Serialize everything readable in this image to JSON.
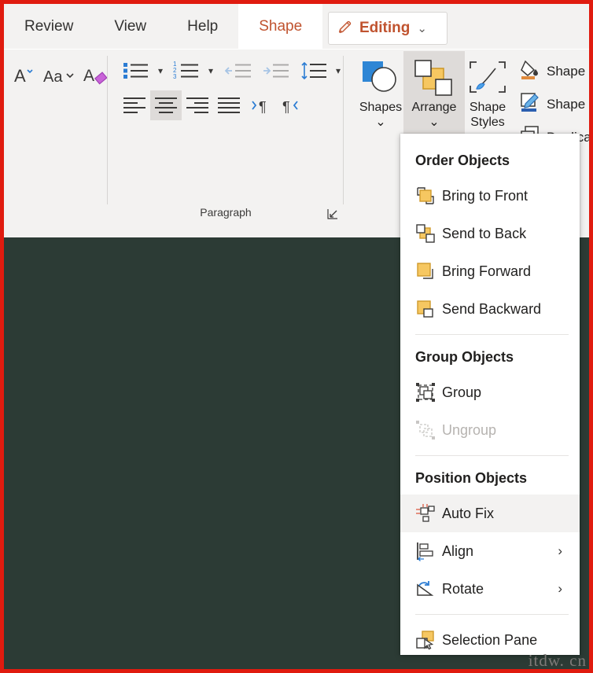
{
  "window": {
    "capture_border_color": "#e01b0f",
    "canvas_color": "#2c3b35",
    "chrome_color": "#f3f2f1",
    "accent_color": "#c0532f"
  },
  "tabs": [
    {
      "label": "Review",
      "selected": false
    },
    {
      "label": "View",
      "selected": false
    },
    {
      "label": "Help",
      "selected": false
    },
    {
      "label": "Shape",
      "selected": true
    }
  ],
  "editing_button": {
    "label": "Editing",
    "icon": "pencil-icon",
    "chevron": "⌄"
  },
  "ribbon": {
    "font_group": {
      "commands": [
        {
          "name": "increase-font-size",
          "glyph": "A",
          "enabled": true
        },
        {
          "name": "change-case",
          "glyph": "Aa",
          "enabled": true
        },
        {
          "name": "clear-formatting",
          "glyph": "A",
          "enabled": true
        }
      ]
    },
    "paragraph_group": {
      "label": "Paragraph",
      "dialog_launcher": "paragraph-dialog-launcher",
      "row1": [
        {
          "name": "bullets",
          "enabled": true,
          "has_chevron": true
        },
        {
          "name": "numbering",
          "enabled": true,
          "has_chevron": true
        },
        {
          "name": "decrease-indent",
          "enabled": false,
          "has_chevron": false
        },
        {
          "name": "increase-indent",
          "enabled": false,
          "has_chevron": false
        },
        {
          "name": "line-spacing",
          "enabled": true,
          "has_chevron": true
        },
        {
          "name": "columns",
          "enabled": true,
          "has_chevron": true
        }
      ],
      "row2": [
        {
          "name": "align-left",
          "enabled": true,
          "selected": false
        },
        {
          "name": "align-center",
          "enabled": true,
          "selected": true
        },
        {
          "name": "align-right",
          "enabled": true,
          "selected": false
        },
        {
          "name": "justify",
          "enabled": true,
          "selected": false
        },
        {
          "name": "text-direction-ltr",
          "enabled": true,
          "selected": false
        },
        {
          "name": "text-direction-rtl",
          "enabled": true,
          "selected": false
        }
      ]
    },
    "gallery": [
      {
        "name": "shapes",
        "label": "Shapes",
        "chevron": "⌄",
        "active": false
      },
      {
        "name": "arrange",
        "label": "Arrange",
        "chevron": "⌄",
        "active": true
      },
      {
        "name": "shape-styles",
        "label": "Shape",
        "label2": "Styles",
        "chevron": "⌄",
        "active": false
      }
    ],
    "commands": [
      {
        "name": "shape-fill",
        "label": "Shape Fill"
      },
      {
        "name": "shape-outline",
        "label": "Shape Outline"
      },
      {
        "name": "duplicate",
        "label": "Duplicate"
      }
    ]
  },
  "arrange_menu": {
    "sections": [
      {
        "heading": "Order Objects",
        "items": [
          {
            "name": "bring-to-front",
            "label": "Bring to Front",
            "icon": "bring-to-front-icon",
            "enabled": true,
            "hover": false,
            "submenu": false
          },
          {
            "name": "send-to-back",
            "label": "Send to Back",
            "icon": "send-to-back-icon",
            "enabled": true,
            "hover": false,
            "submenu": false
          },
          {
            "name": "bring-forward",
            "label": "Bring Forward",
            "icon": "bring-forward-icon",
            "enabled": true,
            "hover": false,
            "submenu": false
          },
          {
            "name": "send-backward",
            "label": "Send Backward",
            "icon": "send-backward-icon",
            "enabled": true,
            "hover": false,
            "submenu": false
          }
        ]
      },
      {
        "heading": "Group Objects",
        "items": [
          {
            "name": "group",
            "label": "Group",
            "icon": "group-icon",
            "enabled": true,
            "hover": false,
            "submenu": false
          },
          {
            "name": "ungroup",
            "label": "Ungroup",
            "icon": "ungroup-icon",
            "enabled": false,
            "hover": false,
            "submenu": false
          }
        ]
      },
      {
        "heading": "Position Objects",
        "items": [
          {
            "name": "auto-fix",
            "label": "Auto Fix",
            "icon": "auto-fix-icon",
            "enabled": true,
            "hover": true,
            "submenu": false
          },
          {
            "name": "align",
            "label": "Align",
            "icon": "align-icon",
            "enabled": true,
            "hover": false,
            "submenu": true,
            "arrow": "›"
          },
          {
            "name": "rotate",
            "label": "Rotate",
            "icon": "rotate-icon",
            "enabled": true,
            "hover": false,
            "submenu": true,
            "arrow": "›"
          },
          {
            "name": "selection-pane",
            "label": "Selection Pane",
            "icon": "selection-pane-icon",
            "enabled": true,
            "hover": false,
            "submenu": false
          }
        ]
      }
    ]
  },
  "watermark": {
    "text": "itdw. cn"
  }
}
